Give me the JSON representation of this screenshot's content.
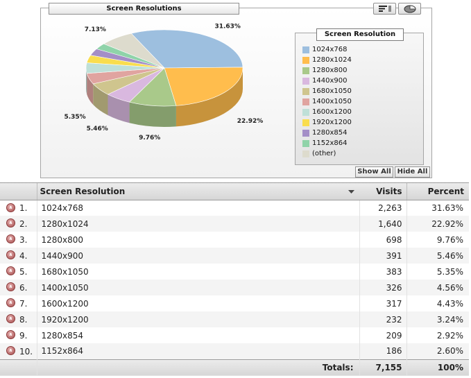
{
  "chart_data": {
    "type": "pie",
    "title": "Screen Resolutions",
    "legend_title": "Screen Resolution",
    "legend_position": "right",
    "categories": [
      "1024x768",
      "1280x1024",
      "1280x800",
      "1440x900",
      "1680x1050",
      "1400x1050",
      "1600x1200",
      "1920x1200",
      "1280x854",
      "1152x864",
      "(other)"
    ],
    "values": [
      31.63,
      22.92,
      9.76,
      5.46,
      5.35,
      4.56,
      4.43,
      3.24,
      2.92,
      2.6,
      7.13
    ],
    "colors": [
      "#9dbfdf",
      "#ffbd4d",
      "#a9c98a",
      "#d9b8df",
      "#cfc58e",
      "#e0a4a0",
      "#bfe0d8",
      "#f9dd4e",
      "#a48ec7",
      "#8fd3a9",
      "#dddbcd"
    ],
    "slice_labels": [
      "31.63%",
      "22.92%",
      "9.76%",
      "5.46%",
      "5.35%",
      "",
      "",
      "",
      "",
      "",
      "7.13%"
    ]
  },
  "controls": {
    "table_view_icon": "bar-list-icon",
    "pie_view_icon": "pie-chart-icon",
    "show_all": "Show All",
    "hide_all": "Hide All"
  },
  "table": {
    "headers": {
      "name": "Screen Resolution",
      "visits": "Visits",
      "percent": "Percent"
    },
    "sort_icon": "sort-desc-icon",
    "rows": [
      {
        "rank": "1.",
        "name": "1024x768",
        "visits": "2,263",
        "percent": "31.63%"
      },
      {
        "rank": "2.",
        "name": "1280x1024",
        "visits": "1,640",
        "percent": "22.92%"
      },
      {
        "rank": "3.",
        "name": "1280x800",
        "visits": "698",
        "percent": "9.76%"
      },
      {
        "rank": "4.",
        "name": "1440x900",
        "visits": "391",
        "percent": "5.46%"
      },
      {
        "rank": "5.",
        "name": "1680x1050",
        "visits": "383",
        "percent": "5.35%"
      },
      {
        "rank": "6.",
        "name": "1400x1050",
        "visits": "326",
        "percent": "4.56%"
      },
      {
        "rank": "7.",
        "name": "1600x1200",
        "visits": "317",
        "percent": "4.43%"
      },
      {
        "rank": "8.",
        "name": "1920x1200",
        "visits": "232",
        "percent": "3.24%"
      },
      {
        "rank": "9.",
        "name": "1280x854",
        "visits": "209",
        "percent": "2.92%"
      },
      {
        "rank": "10.",
        "name": "1152x864",
        "visits": "186",
        "percent": "2.60%"
      }
    ],
    "totals": {
      "label": "Totals:",
      "visits": "7,155",
      "percent": "100%"
    }
  }
}
